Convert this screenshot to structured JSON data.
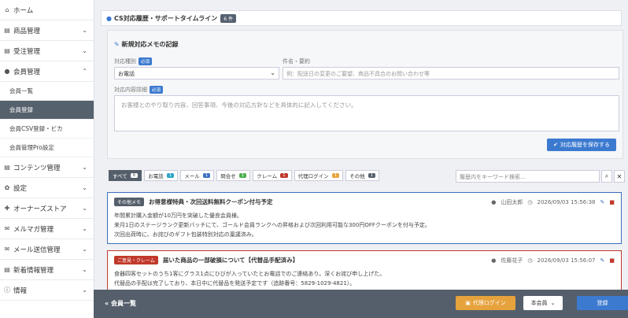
{
  "sidebar": {
    "items": [
      {
        "icon": "home-icon",
        "glyph": "⌂",
        "label": "ホーム",
        "chev": ""
      },
      {
        "icon": "product-icon",
        "glyph": "▤",
        "label": "商品管理",
        "chev": "⌄"
      },
      {
        "icon": "order-icon",
        "glyph": "▤",
        "label": "受注管理",
        "chev": "⌄"
      },
      {
        "icon": "member-icon",
        "glyph": "●",
        "label": "会員管理",
        "chev": "⌃"
      }
    ],
    "sub": [
      {
        "label": "会員一覧",
        "active": false
      },
      {
        "label": "会員登録",
        "active": true
      },
      {
        "label": "会員CSV登録・ビカ",
        "active": false
      },
      {
        "label": "会員管理Pro設定",
        "active": false
      }
    ],
    "items2": [
      {
        "icon": "content-icon",
        "glyph": "▤",
        "label": "コンテンツ管理",
        "chev": "⌄"
      },
      {
        "icon": "settings-icon",
        "glyph": "✿",
        "label": "設定",
        "chev": "⌄"
      },
      {
        "icon": "owners-store-icon",
        "glyph": "✚",
        "label": "オーナーズストア",
        "chev": "⌄"
      },
      {
        "icon": "mail-magazine-icon",
        "glyph": "✉",
        "label": "メルマガ管理",
        "chev": "⌄"
      },
      {
        "icon": "mail-send-icon",
        "glyph": "✉",
        "label": "メール送信管理",
        "chev": "⌄"
      },
      {
        "icon": "news-icon",
        "glyph": "▤",
        "label": "新着情報管理",
        "chev": "⌄"
      },
      {
        "icon": "info-icon",
        "glyph": "ⓘ",
        "label": "情報",
        "chev": "⌄"
      }
    ]
  },
  "header": {
    "title": "CS対応履歴・サポートタイムライン",
    "badge": "6 件"
  },
  "memo": {
    "title": "新規対応メモの記録",
    "type_label": "対応種別",
    "type_req": "必須",
    "type_value": "お電話",
    "subject_label": "件名・要約",
    "subject_placeholder": "例：配送日の変更のご要望、商品不具合のお問い合わせ等",
    "detail_label": "対応内容詳細",
    "detail_req": "必須",
    "detail_placeholder": "お客様とのやり取り内容、回答事項、今後の対応方針などを具体的に記入してください。",
    "save_label": "対応履歴を保存する"
  },
  "filters": [
    {
      "label": "すべて",
      "count": "6",
      "active": true,
      "color": "#555f6b"
    },
    {
      "label": "お電話",
      "count": "1",
      "active": false,
      "color": "#2aa3c6"
    },
    {
      "label": "メール",
      "count": "1",
      "active": false,
      "color": "#3c6fc0"
    },
    {
      "label": "問合せ",
      "count": "1",
      "active": false,
      "color": "#4caf50"
    },
    {
      "label": "クレーム",
      "count": "1",
      "active": false,
      "color": "#c0392b"
    },
    {
      "label": "代理ログイン",
      "count": "1",
      "active": false,
      "color": "#e6a23c"
    },
    {
      "label": "その他",
      "count": "1",
      "active": false,
      "color": "#555f6b"
    }
  ],
  "search_placeholder": "履歴内をキーワード検索...",
  "entries": [
    {
      "type": "その他メモ",
      "type_color": "#555f6b",
      "title": "お得意様特典・次回送料無料クーポン付与予定",
      "author": "山田太郎",
      "date": "2026/09/03 15:56:38",
      "body": [
        "年間累計購入金額が10万円を突破した優良会員様。",
        "来月1日のステージランク更新バッチにて、ゴールド会員ランクへの昇格および次回利用可能な300円OFFクーポンを付与予定。",
        "次回出荷時に、お詫びのギフト包装特別対応の稟議済み。"
      ]
    },
    {
      "type": "ご意見・クレーム",
      "type_color": "#c0392b",
      "title": "届いた商品の一部破損について【代替品手配済み】",
      "author": "佐藤花子",
      "date": "2026/09/03 15:56:07",
      "body": [
        "食器四客セットのうち1客にグラス1点にひびが入っていたとお電話でのご連絡あり。深くお詫び申し上げた。",
        "代替品の手配は完了しており、本日中に代替品を発送予定です（追跡番号：5829-1029-4821）。"
      ]
    }
  ],
  "bottom": {
    "title": "会員一覧",
    "proxy_label": "代理ログイン",
    "select_label": "本会員",
    "register_label": "登録"
  }
}
